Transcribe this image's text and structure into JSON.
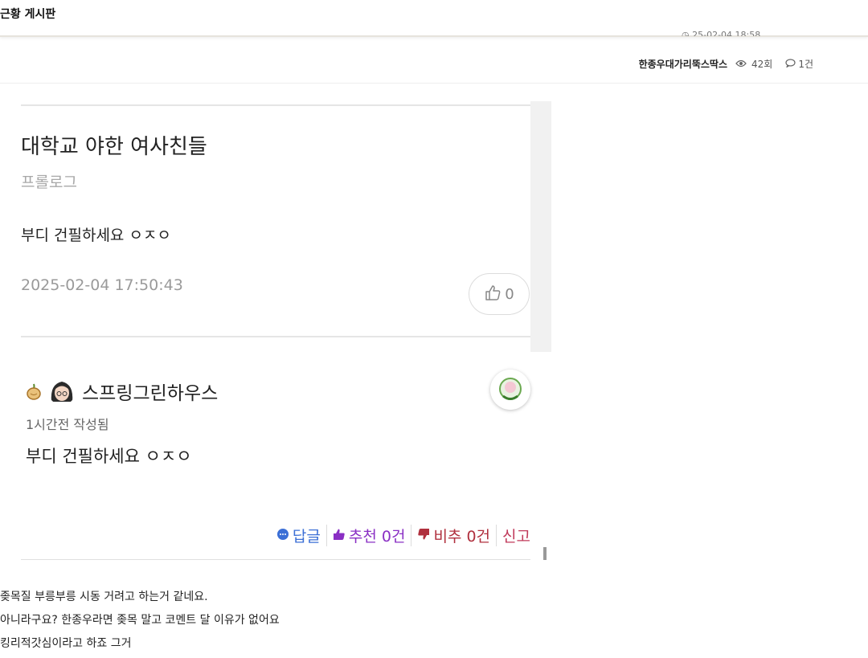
{
  "header": {
    "board_title": "근황 게시판",
    "cut_time": "25-02-04 18:58"
  },
  "meta": {
    "author": "한종우대가리뚝스딱스",
    "views": "42회",
    "comments": "1건",
    "views_icon": "eye-icon",
    "comments_icon": "speech-bubble-icon"
  },
  "post": {
    "title": "대학교 야한 여사친들",
    "subtitle": "프롤로그",
    "body": "부디 건필하세요 ㅇㅈㅇ",
    "date": "2025-02-04 17:50:43",
    "like_count": "0",
    "like_icon": "thumbs-up-icon"
  },
  "comment": {
    "author": "스프링그린하우스",
    "time": "1시간전 작성됨",
    "body": "부디 건필하세요 ㅇㅈㅇ",
    "actions": {
      "reply": "답글",
      "recommend": "추천 0건",
      "not_recommend": "비추 0건",
      "report": "신고"
    }
  },
  "replies": [
    "좆목질 부릉부릉 시동 거려고 하는거 같네요.",
    "아니라구요? 한종우라면 좆목 말고 코멘트 달 이유가 없어요",
    "킹리적갓심이라고 하죠 그거"
  ],
  "colors": {
    "reply": "#3b6fd6",
    "recommend": "#8a2fc4",
    "not_recommend": "#b0303e",
    "report": "#c0395a"
  }
}
